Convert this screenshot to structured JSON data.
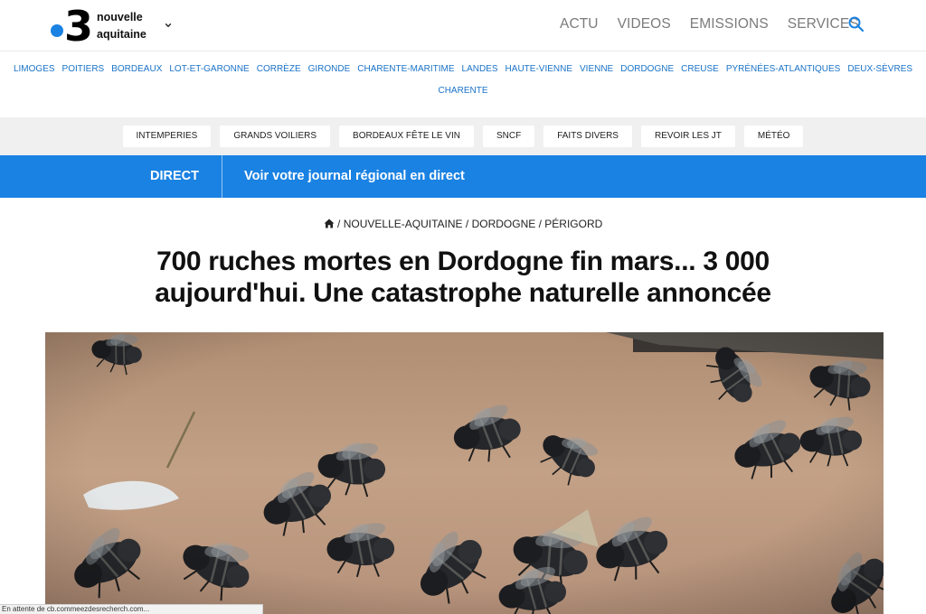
{
  "header": {
    "logo": {
      "number": "3",
      "line1": "nouvelle",
      "line2": "aquitaine"
    },
    "nav": [
      "ACTU",
      "VIDEOS",
      "EMISSIONS",
      "SERVICES"
    ],
    "brand_color": "#1a82e2",
    "search_icon": "search-icon"
  },
  "regions": [
    "LIMOGES",
    "POITIERS",
    "BORDEAUX",
    "LOT-ET-GARONNE",
    "CORRÈZE",
    "GIRONDE",
    "CHARENTE-MARITIME",
    "LANDES",
    "HAUTE-VIENNE",
    "VIENNE",
    "DORDOGNE",
    "CREUSE",
    "PYRÉNÉES-ATLANTIQUES",
    "DEUX-SÈVRES",
    "CHARENTE"
  ],
  "tags": [
    "INTEMPERIES",
    "GRANDS VOILIERS",
    "BORDEAUX FÊTE LE VIN",
    "SNCF",
    "FAITS DIVERS",
    "REVOIR LES JT",
    "MÉTÉO"
  ],
  "direct": {
    "label": "DIRECT",
    "text": "Voir votre journal régional en direct"
  },
  "breadcrumb": {
    "home_icon": "home-icon",
    "items": [
      "NOUVELLE-AQUITAINE",
      "DORDOGNE",
      "PÉRIGORD"
    ],
    "separator": "/"
  },
  "article": {
    "title": "700 ruches mortes en Dordogne fin mars... 3 000 aujourd'hui. Une catastrophe naturelle annoncée"
  },
  "status_bar": {
    "text": "En attente de cb.commeezdesrecherch.com..."
  }
}
